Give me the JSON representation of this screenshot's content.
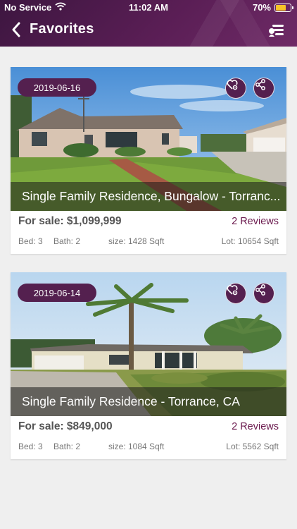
{
  "status_bar": {
    "carrier": "No Service",
    "time": "11:02 AM",
    "battery": "70%",
    "battery_level": 0.7,
    "battery_color": "#f6c429"
  },
  "nav": {
    "title": "Favorites",
    "back_icon": "chevron-left-icon",
    "menu_icon": "filter-menu-icon"
  },
  "colors": {
    "brand": "#54204f",
    "header": "#4a1a4a",
    "reviews": "#6b1a4e"
  },
  "listings": [
    {
      "date": "2019-06-16",
      "title": "Single Family Residence, Bungalow - Torranc...",
      "price": "For sale: $1,099,999",
      "reviews": "2 Reviews",
      "bed": "Bed: 3",
      "bath": "Bath: 2",
      "size": "size: 1428 Sqft",
      "lot": "Lot: 10654 Sqft"
    },
    {
      "date": "2019-06-14",
      "title": "Single Family Residence - Torrance, CA",
      "price": "For sale: $849,000",
      "reviews": "2 Reviews",
      "bed": "Bed: 3",
      "bath": "Bath: 2",
      "size": "size: 1084 Sqft",
      "lot": "Lot: 5562 Sqft"
    }
  ]
}
